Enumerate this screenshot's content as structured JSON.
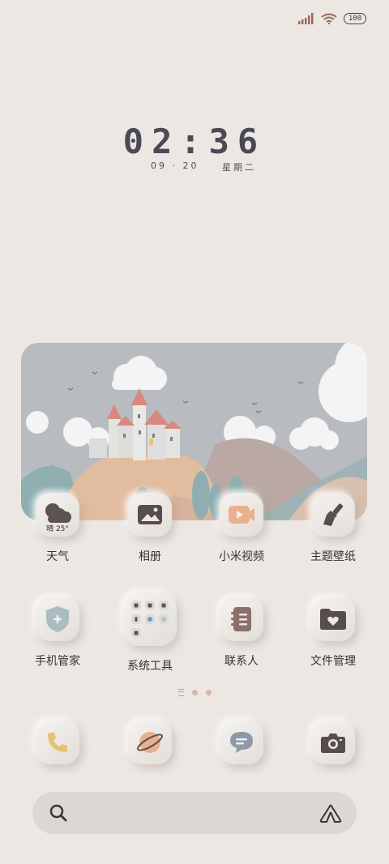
{
  "status_bar": {
    "battery": "100",
    "icons": [
      "signal-icon",
      "wifi-icon",
      "battery-icon"
    ]
  },
  "clock": {
    "time": "02:36",
    "date": "09 · 20",
    "weekday": "星期二"
  },
  "apps_row1": [
    {
      "label": "天气",
      "sub": "晴 25°",
      "icon": "weather-icon"
    },
    {
      "label": "相册",
      "icon": "gallery-icon"
    },
    {
      "label": "小米视频",
      "icon": "video-icon"
    },
    {
      "label": "主题壁纸",
      "icon": "brush-icon"
    }
  ],
  "apps_row2": [
    {
      "label": "手机管家",
      "icon": "shield-icon"
    },
    {
      "label": "系统工具",
      "icon": "folder-grid-icon"
    },
    {
      "label": "联系人",
      "icon": "contacts-icon"
    },
    {
      "label": "文件管理",
      "icon": "file-folder-icon"
    }
  ],
  "dock": [
    {
      "icon": "phone-icon"
    },
    {
      "icon": "browser-icon"
    },
    {
      "icon": "message-icon"
    },
    {
      "icon": "camera-icon"
    }
  ],
  "colors": {
    "background": "#ece7e3",
    "accent_peach": "#e8b08c",
    "icon_dark": "#5a4f4f"
  }
}
